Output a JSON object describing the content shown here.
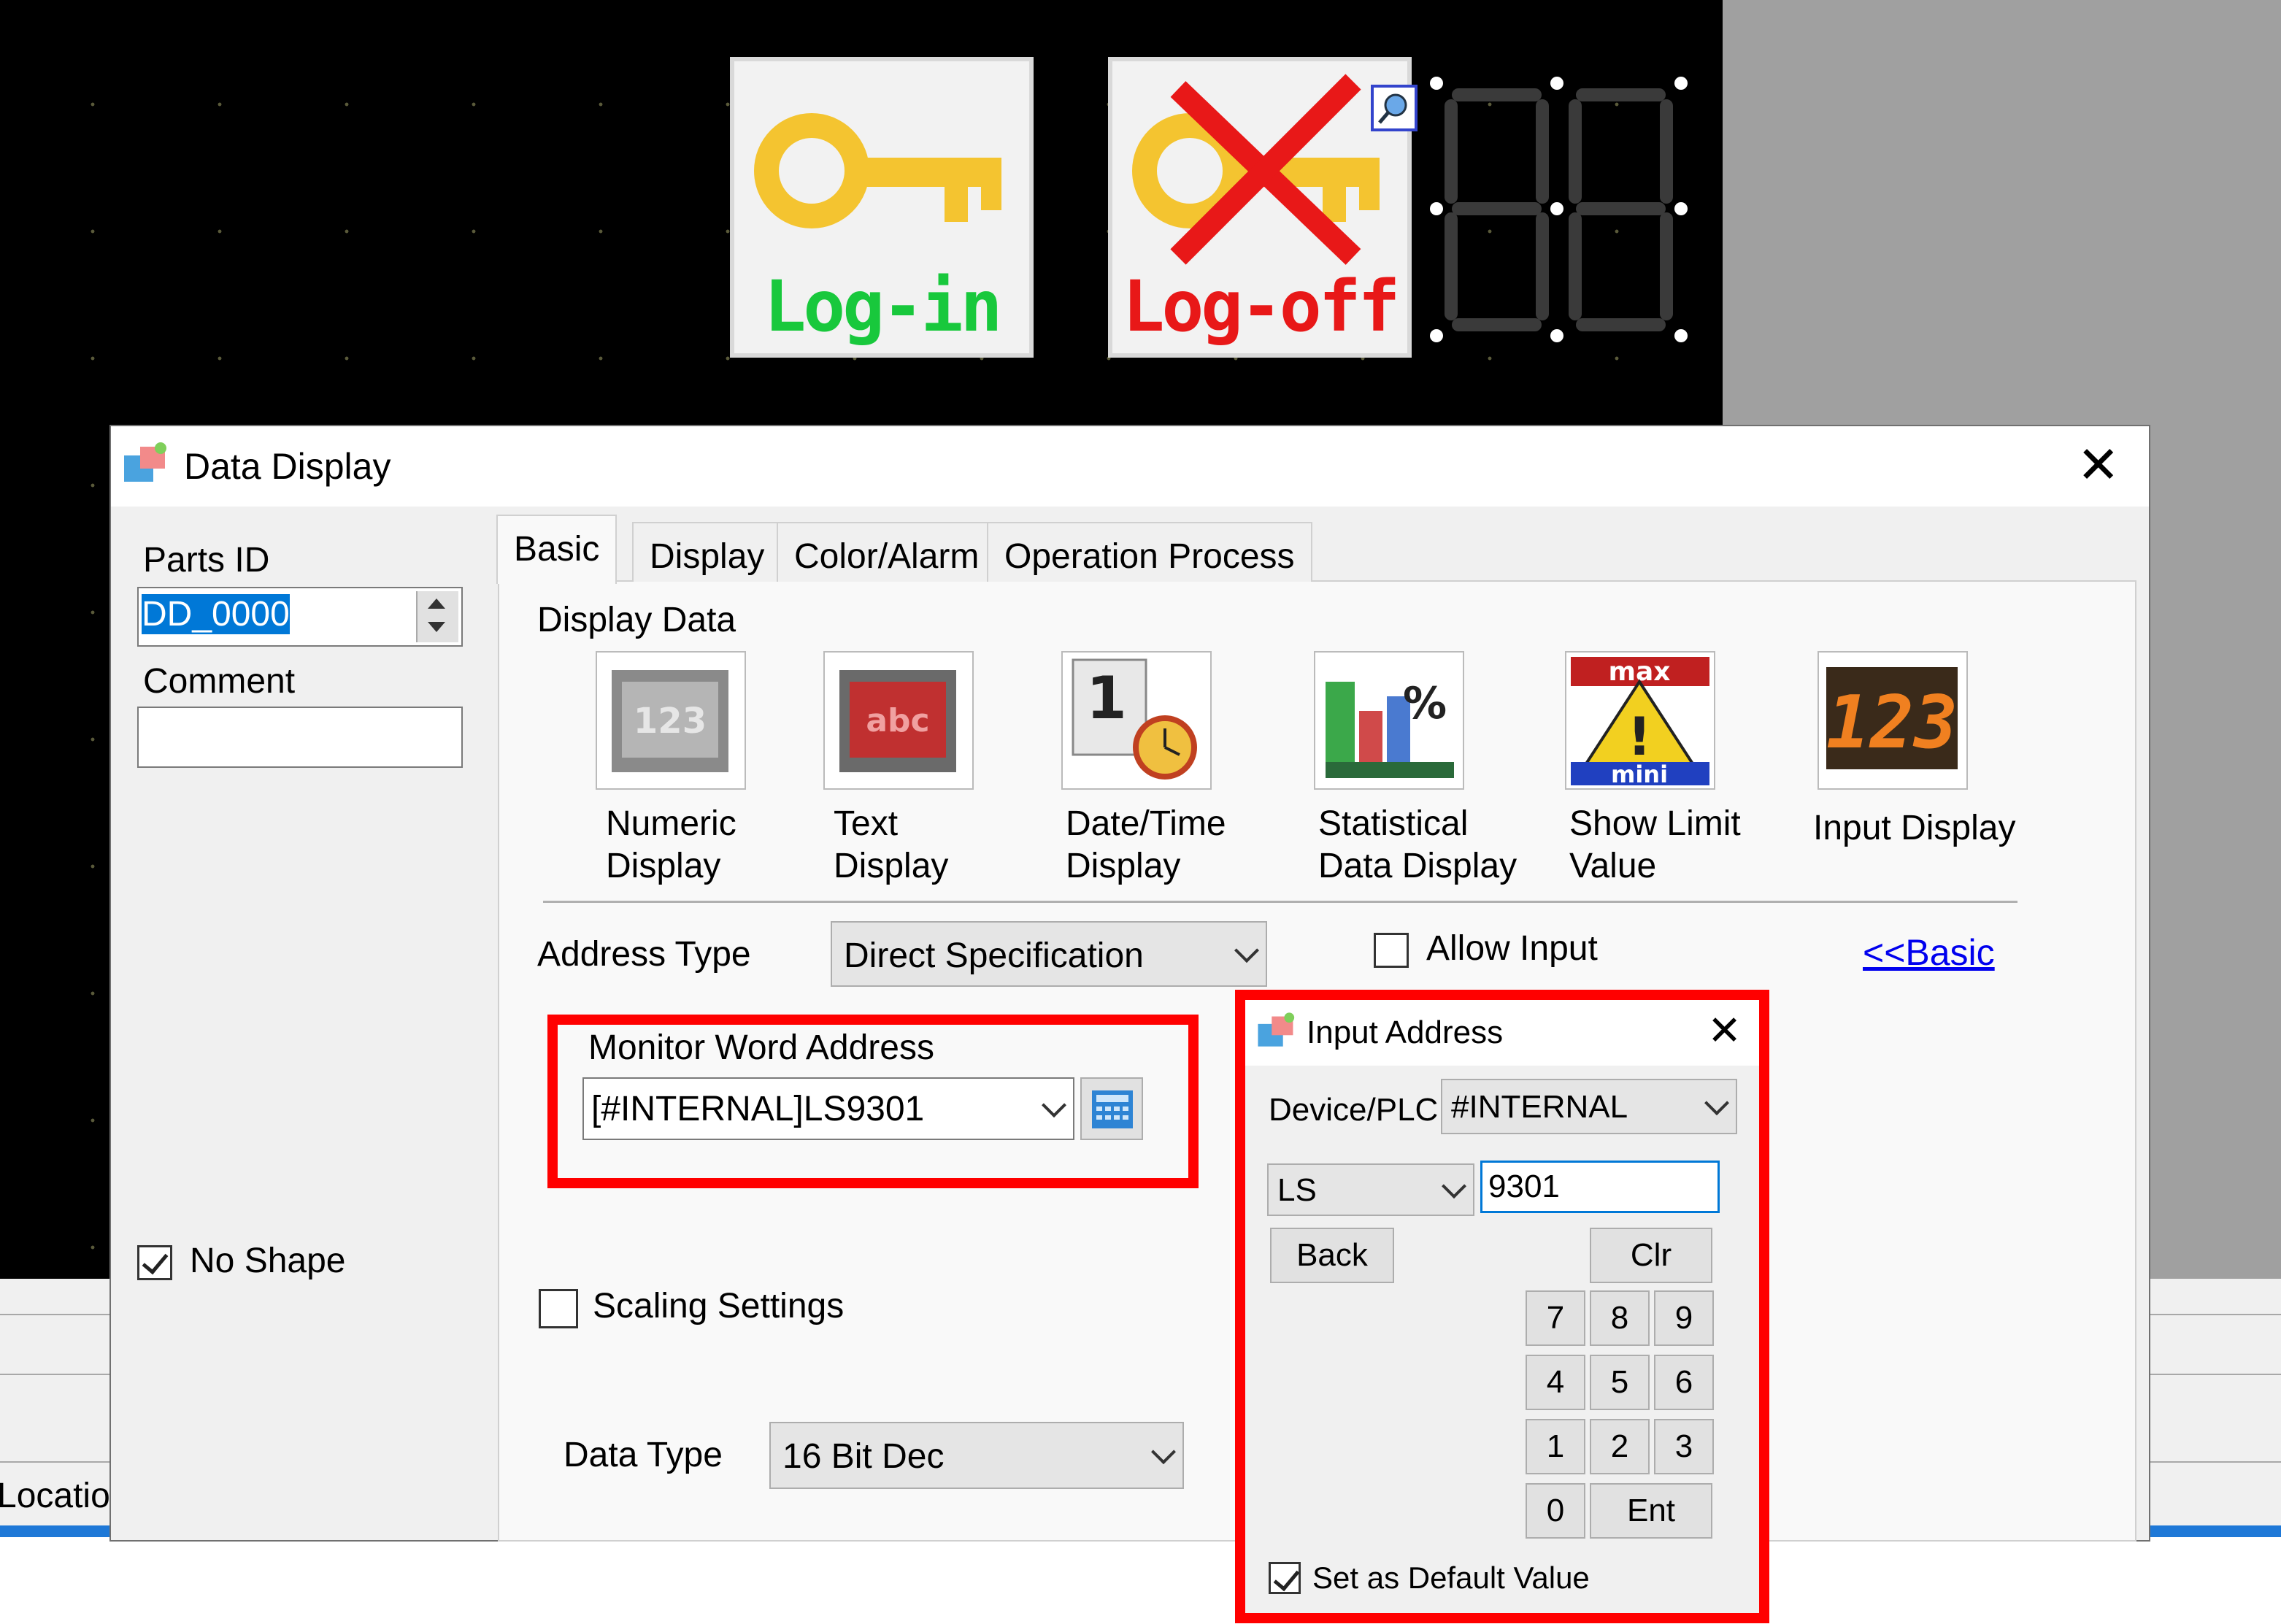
{
  "screen": {
    "login_switch_label": "Log-in",
    "logoff_switch_label": "Log-off",
    "seven_segment_value": "88",
    "status_location_text": "Locatio"
  },
  "dialog": {
    "title": "Data Display",
    "parts_id_label": "Parts ID",
    "parts_id_value": "DD_0000",
    "comment_label": "Comment",
    "comment_value": "",
    "no_shape_label": "No Shape",
    "no_shape_checked": true,
    "tabs": [
      {
        "label": "Basic",
        "active": true
      },
      {
        "label": "Display",
        "active": false
      },
      {
        "label": "Color/Alarm",
        "active": false
      },
      {
        "label": "Operation Process",
        "active": false
      }
    ],
    "display_data_label": "Display Data",
    "display_types": [
      {
        "line1": "Numeric",
        "line2": "Display",
        "icon": "numeric-display-icon"
      },
      {
        "line1": "Text",
        "line2": "Display",
        "icon": "text-display-icon"
      },
      {
        "line1": "Date/Time",
        "line2": "Display",
        "icon": "date-time-display-icon"
      },
      {
        "line1": "Statistical",
        "line2": "Data Display",
        "icon": "statistical-data-display-icon"
      },
      {
        "line1": "Show Limit",
        "line2": "Value",
        "icon": "show-limit-value-icon"
      },
      {
        "line1": "Input Display",
        "line2": "",
        "icon": "input-display-icon"
      }
    ],
    "address_type_label": "Address Type",
    "address_type_value": "Direct Specification",
    "allow_input_label": "Allow Input",
    "allow_input_checked": false,
    "basic_link": "<<Basic",
    "monitor_word_address_label": "Monitor Word Address",
    "monitor_word_address_value": "[#INTERNAL]LS9301",
    "scaling_settings_label": "Scaling Settings",
    "scaling_checked": false,
    "data_type_label": "Data Type",
    "data_type_value": "16 Bit Dec"
  },
  "input_address": {
    "title": "Input Address",
    "device_plc_label": "Device/PLC",
    "device_plc_value": "#INTERNAL",
    "device_type_value": "LS",
    "address_value": "9301",
    "back_label": "Back",
    "clr_label": "Clr",
    "keys": [
      "7",
      "8",
      "9",
      "4",
      "5",
      "6",
      "1",
      "2",
      "3",
      "0"
    ],
    "ent_label": "Ent",
    "set_default_label": "Set as Default Value",
    "set_default_checked": true
  },
  "colors": {
    "highlight_red": "#ff0000",
    "login_green": "#18c83c",
    "logoff_red": "#e81818",
    "key_gold": "#f4c430",
    "link_blue": "#0000ee"
  }
}
